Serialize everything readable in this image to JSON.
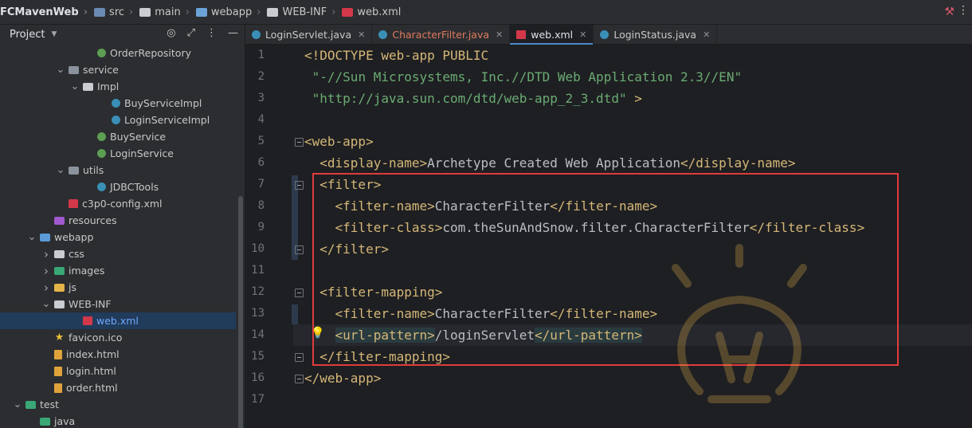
{
  "breadcrumb": {
    "items": [
      "FCMavenWeb",
      "src",
      "main",
      "webapp",
      "WEB-INF",
      "web.xml"
    ]
  },
  "project_panel": {
    "title": "Project",
    "tree": [
      {
        "label": "OrderRepository",
        "icon": "interface-icon",
        "depth": 6,
        "chev": ""
      },
      {
        "label": "service",
        "icon": "package-icon",
        "depth": 4,
        "chev": "open"
      },
      {
        "label": "Impl",
        "icon": "folder-icon",
        "depth": 5,
        "chev": "open"
      },
      {
        "label": "BuyServiceImpl",
        "icon": "class-icon",
        "depth": 7,
        "chev": ""
      },
      {
        "label": "LoginServiceImpl",
        "icon": "class-icon",
        "depth": 7,
        "chev": ""
      },
      {
        "label": "BuyService",
        "icon": "interface-icon",
        "depth": 6,
        "chev": ""
      },
      {
        "label": "LoginService",
        "icon": "interface-icon",
        "depth": 6,
        "chev": ""
      },
      {
        "label": "utils",
        "icon": "package-icon",
        "depth": 4,
        "chev": "open"
      },
      {
        "label": "JDBCTools",
        "icon": "class-icon",
        "depth": 6,
        "chev": ""
      },
      {
        "label": "c3p0-config.xml",
        "icon": "xml-icon",
        "depth": 4,
        "chev": ""
      },
      {
        "label": "resources",
        "icon": "resources-folder-icon",
        "depth": 3,
        "chev": ""
      },
      {
        "label": "webapp",
        "icon": "web-folder-icon",
        "depth": 2,
        "chev": "open"
      },
      {
        "label": "css",
        "icon": "folder-icon",
        "depth": 3,
        "chev": "closed"
      },
      {
        "label": "images",
        "icon": "image-folder-icon",
        "depth": 3,
        "chev": "closed"
      },
      {
        "label": "js",
        "icon": "js-folder-icon",
        "depth": 3,
        "chev": "closed"
      },
      {
        "label": "WEB-INF",
        "icon": "folder-icon",
        "depth": 3,
        "chev": "open"
      },
      {
        "label": "web.xml",
        "icon": "xml-icon",
        "depth": 5,
        "chev": "",
        "selected": true
      },
      {
        "label": "favicon.ico",
        "icon": "star-icon",
        "depth": 3,
        "chev": ""
      },
      {
        "label": "index.html",
        "icon": "html-icon",
        "depth": 3,
        "chev": ""
      },
      {
        "label": "login.html",
        "icon": "html-icon",
        "depth": 3,
        "chev": ""
      },
      {
        "label": "order.html",
        "icon": "html-icon",
        "depth": 3,
        "chev": ""
      },
      {
        "label": "test",
        "icon": "test-folder-icon",
        "depth": 1,
        "chev": "open"
      },
      {
        "label": "java",
        "icon": "test-folder-icon",
        "depth": 2,
        "chev": ""
      }
    ]
  },
  "tabs": [
    {
      "label": "LoginServlet.java",
      "icon": "class-icon",
      "active": false
    },
    {
      "label": "CharacterFilter.java",
      "icon": "class-icon",
      "active": false,
      "modified": true
    },
    {
      "label": "web.xml",
      "icon": "xml-icon",
      "active": true
    },
    {
      "label": "LoginStatus.java",
      "icon": "class-icon",
      "active": false
    }
  ],
  "editor": {
    "lines": [
      "<!DOCTYPE web-app PUBLIC",
      " \"-//Sun Microsystems, Inc.//DTD Web Application 2.3//EN\"",
      " \"http://java.sun.com/dtd/web-app_2_3.dtd\" >",
      "",
      "<web-app>",
      "  <display-name>Archetype Created Web Application</display-name>",
      "  <filter>",
      "    <filter-name>CharacterFilter</filter-name>",
      "    <filter-class>com.theSunAndSnow.filter.CharacterFilter</filter-class>",
      "  </filter>",
      "",
      "  <filter-mapping>",
      "    <filter-name>CharacterFilter</filter-name>",
      "    <url-pattern>/loginServlet</url-pattern>",
      "  </filter-mapping>",
      "</web-app>",
      ""
    ]
  },
  "colors": {
    "tag": "#d5b778",
    "string": "#6aab73",
    "text": "#bcbec4",
    "highlight_box": "#e03c3c"
  }
}
